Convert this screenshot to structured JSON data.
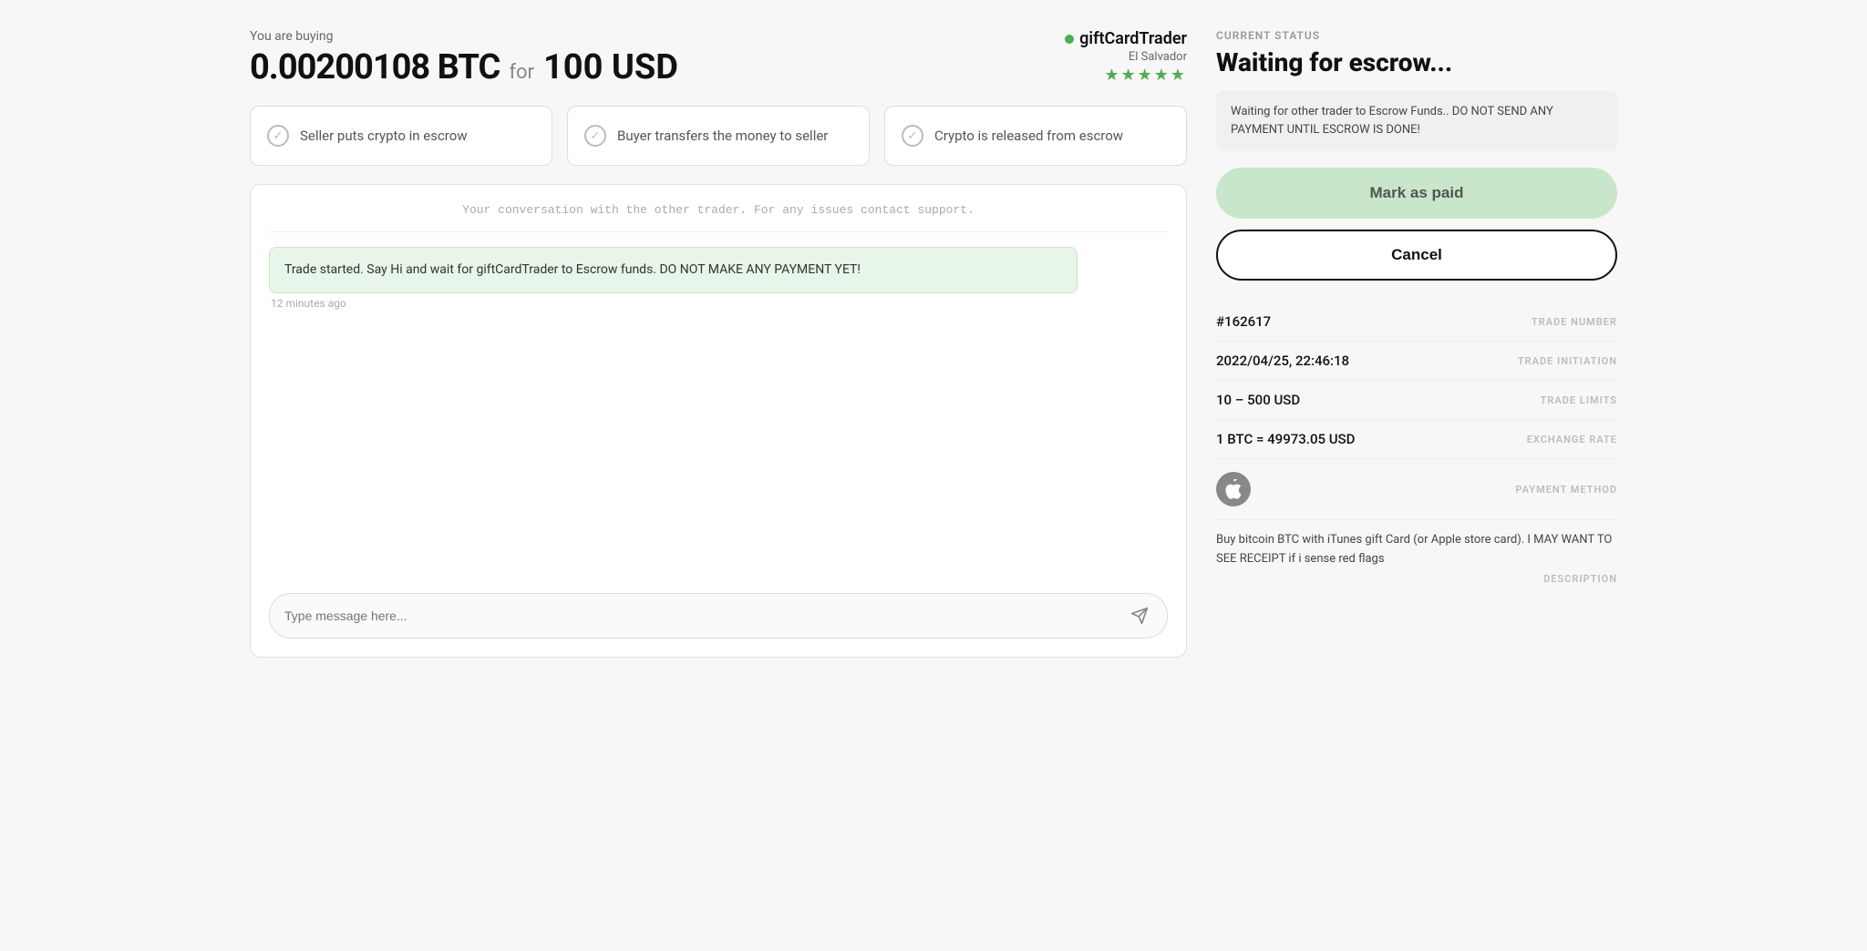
{
  "header": {
    "you_are_buying": "You are buying",
    "btc_amount": "0.00200108 BTC",
    "for_label": "for",
    "usd_amount": "100 USD"
  },
  "trader": {
    "name": "giftCardTrader",
    "location": "El Salvador",
    "stars": "★★★★★"
  },
  "steps": [
    {
      "label": "Seller puts crypto in escrow"
    },
    {
      "label": "Buyer transfers the money to seller"
    },
    {
      "label": "Crypto is released from escrow"
    }
  ],
  "chat": {
    "hint": "Your conversation with the other trader. For any issues contact support.",
    "messages": [
      {
        "text": "Trade started. Say Hi and wait for giftCardTrader to Escrow funds. DO NOT MAKE ANY PAYMENT YET!",
        "timestamp": "12 minutes ago"
      }
    ],
    "input_placeholder": "Type message here..."
  },
  "sidebar": {
    "current_status_label": "CURRENT STATUS",
    "status_title": "Waiting for escrow...",
    "warning_text": "Waiting for other trader to Escrow Funds.. DO NOT SEND ANY PAYMENT UNTIL ESCROW IS DONE!",
    "mark_paid_label": "Mark as paid",
    "cancel_label": "Cancel",
    "trade_number": "#162617",
    "trade_number_label": "TRADE NUMBER",
    "trade_initiation": "2022/04/25, 22:46:18",
    "trade_initiation_label": "TRADE INITIATION",
    "trade_limits": "10 – 500 USD",
    "trade_limits_label": "TRADE LIMITS",
    "exchange_rate": "1 BTC = 49973.05 USD",
    "exchange_rate_label": "EXCHANGE RATE",
    "payment_method_label": "PAYMENT METHOD",
    "description": "Buy bitcoin BTC with iTunes gift Card (or Apple store card). I MAY WANT TO SEE RECEIPT if i sense red flags",
    "description_label": "DESCRIPTION"
  }
}
